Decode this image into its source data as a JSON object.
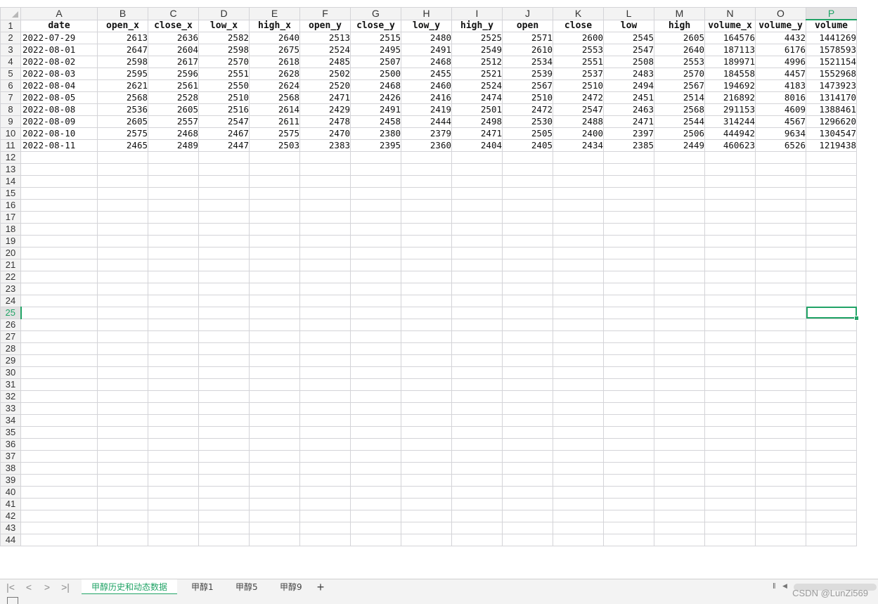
{
  "columns": [
    "A",
    "B",
    "C",
    "D",
    "E",
    "F",
    "G",
    "H",
    "I",
    "J",
    "K",
    "L",
    "M",
    "N",
    "O",
    "P"
  ],
  "active_column": "P",
  "header_row": [
    "date",
    "open_x",
    "close_x",
    "low_x",
    "high_x",
    "open_y",
    "close_y",
    "low_y",
    "high_y",
    "open",
    "close",
    "low",
    "high",
    "volume_x",
    "volume_y",
    "volume"
  ],
  "rows": [
    [
      "2022-07-29",
      "2613",
      "2636",
      "2582",
      "2640",
      "2513",
      "2515",
      "2480",
      "2525",
      "2571",
      "2600",
      "2545",
      "2605",
      "164576",
      "4432",
      "1441269"
    ],
    [
      "2022-08-01",
      "2647",
      "2604",
      "2598",
      "2675",
      "2524",
      "2495",
      "2491",
      "2549",
      "2610",
      "2553",
      "2547",
      "2640",
      "187113",
      "6176",
      "1578593"
    ],
    [
      "2022-08-02",
      "2598",
      "2617",
      "2570",
      "2618",
      "2485",
      "2507",
      "2468",
      "2512",
      "2534",
      "2551",
      "2508",
      "2553",
      "189971",
      "4996",
      "1521154"
    ],
    [
      "2022-08-03",
      "2595",
      "2596",
      "2551",
      "2628",
      "2502",
      "2500",
      "2455",
      "2521",
      "2539",
      "2537",
      "2483",
      "2570",
      "184558",
      "4457",
      "1552968"
    ],
    [
      "2022-08-04",
      "2621",
      "2561",
      "2550",
      "2624",
      "2520",
      "2468",
      "2460",
      "2524",
      "2567",
      "2510",
      "2494",
      "2567",
      "194692",
      "4183",
      "1473923"
    ],
    [
      "2022-08-05",
      "2568",
      "2528",
      "2510",
      "2568",
      "2471",
      "2426",
      "2416",
      "2474",
      "2510",
      "2472",
      "2451",
      "2514",
      "216892",
      "8016",
      "1314170"
    ],
    [
      "2022-08-08",
      "2536",
      "2605",
      "2516",
      "2614",
      "2429",
      "2491",
      "2419",
      "2501",
      "2472",
      "2547",
      "2463",
      "2568",
      "291153",
      "4609",
      "1388461"
    ],
    [
      "2022-08-09",
      "2605",
      "2557",
      "2547",
      "2611",
      "2478",
      "2458",
      "2444",
      "2498",
      "2530",
      "2488",
      "2471",
      "2544",
      "314244",
      "4567",
      "1296620"
    ],
    [
      "2022-08-10",
      "2575",
      "2468",
      "2467",
      "2575",
      "2470",
      "2380",
      "2379",
      "2471",
      "2505",
      "2400",
      "2397",
      "2506",
      "444942",
      "9634",
      "1304547"
    ],
    [
      "2022-08-11",
      "2465",
      "2489",
      "2447",
      "2503",
      "2383",
      "2395",
      "2360",
      "2404",
      "2405",
      "2434",
      "2385",
      "2449",
      "460623",
      "6526",
      "1219438"
    ]
  ],
  "total_rows": 44,
  "selected_cell": {
    "row": 25,
    "col": "P"
  },
  "sheet_tabs": [
    {
      "label": "甲醇历史和动态数据",
      "active": true
    },
    {
      "label": "甲醇1",
      "active": false
    },
    {
      "label": "甲醇5",
      "active": false
    },
    {
      "label": "甲醇9",
      "active": false
    }
  ],
  "add_sheet_symbol": "+",
  "nav_symbols": [
    "|<",
    "<",
    ">",
    ">|"
  ],
  "watermark": "CSDN @LunZi569",
  "accent_color": "#21a366"
}
